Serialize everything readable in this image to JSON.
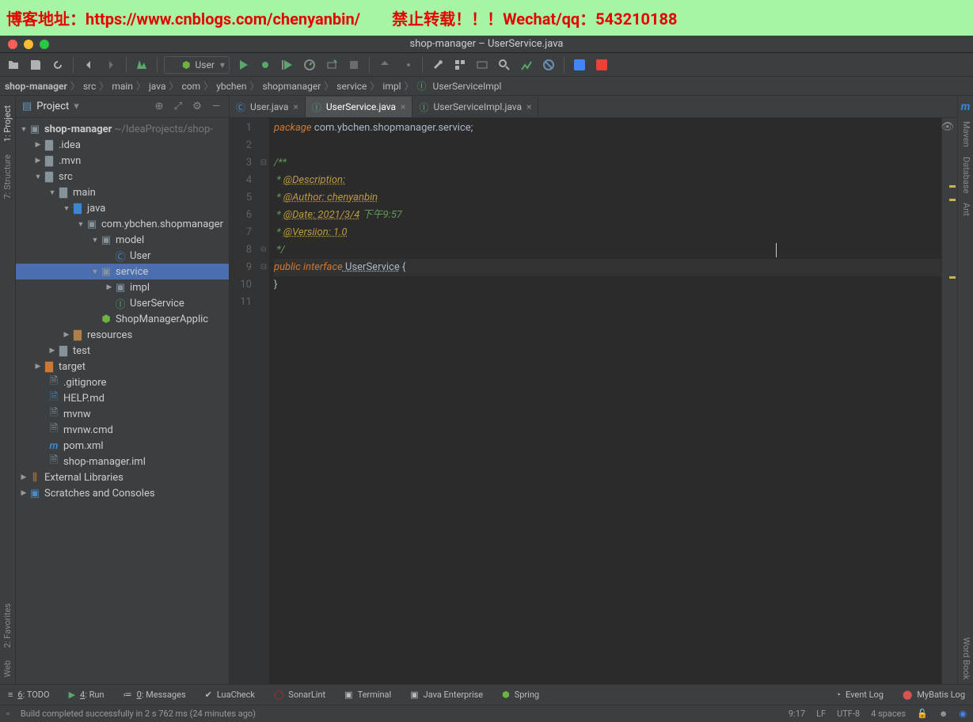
{
  "banner": {
    "blog_label": "博客地址：https://www.cnblogs.com/chenyanbin/",
    "warning": "禁止转载！！！Wechat/qq：543210188"
  },
  "window_title": "shop-manager – UserService.java",
  "run_config": "User",
  "breadcrumbs": [
    "shop-manager",
    "src",
    "main",
    "java",
    "com",
    "ybchen",
    "shopmanager",
    "service",
    "impl",
    "UserServiceImpl"
  ],
  "panel": {
    "title": "Project"
  },
  "tree": {
    "root": "shop-manager",
    "root_path": "~/IdeaProjects/shop-",
    "items": {
      "idea": ".idea",
      "mvn": ".mvn",
      "src": "src",
      "main": "main",
      "java": "java",
      "pkg": "com.ybchen.shopmanager",
      "model": "model",
      "user": "User",
      "service": "service",
      "impl": "impl",
      "userservice": "UserService",
      "app": "ShopManagerApplic",
      "resources": "resources",
      "test": "test",
      "target": "target",
      "gitignore": ".gitignore",
      "help": "HELP.md",
      "mvnw": "mvnw",
      "mvnwcmd": "mvnw.cmd",
      "pom": "pom.xml",
      "iml": "shop-manager.iml",
      "ext": "External Libraries",
      "scratch": "Scratches and Consoles"
    }
  },
  "tabs": [
    {
      "label": "User.java",
      "icon": "class",
      "active": false
    },
    {
      "label": "UserService.java",
      "icon": "interface",
      "active": true
    },
    {
      "label": "UserServiceImpl.java",
      "icon": "interface",
      "active": false
    }
  ],
  "editor": {
    "line_numbers": [
      "1",
      "2",
      "3",
      "4",
      "5",
      "6",
      "7",
      "8",
      "9",
      "10",
      "11"
    ],
    "lines": {
      "package_kw": "package",
      "package_val": " com.ybchen.shopmanager.service;",
      "jdoc_open": "/**",
      "desc_pre": " * ",
      "desc_tag": "@Description:",
      "author_pre": " * ",
      "author_tag": "@Author:",
      "author_val": " chenyanbin",
      "date_pre": " * ",
      "date_tag": "@Date:",
      "date_val": " 2021/3/4",
      "date_time": " 下午9:57",
      "version_pre": " * ",
      "version_tag": "@Versiion:",
      "version_val": " 1.0",
      "jdoc_close": " */",
      "public_kw": "public",
      "interface_kw": " interface",
      "iface_name": " UserService",
      "open_brace": " {",
      "close_brace": "}"
    }
  },
  "bottom_tools": {
    "todo": "TODO",
    "todo_num": "6",
    "run": "Run",
    "run_num": "4",
    "messages": "Messages",
    "messages_num": "0",
    "luacheck": "LuaCheck",
    "sonarlint": "SonarLint",
    "terminal": "Terminal",
    "java_ee": "Java Enterprise",
    "spring": "Spring",
    "eventlog": "Event Log",
    "mybatis": "MyBatis Log"
  },
  "status": {
    "message": "Build completed successfully in 2 s 762 ms (24 minutes ago)",
    "pos": "9:17",
    "sep": "LF",
    "enc": "UTF-8",
    "indent": "4 spaces"
  },
  "left_tools": {
    "project": "1: Project",
    "structure": "7: Structure",
    "favorites": "2: Favorites",
    "web": "Web"
  },
  "right_tools": {
    "maven": "Maven",
    "database": "Database",
    "ant": "Ant",
    "wordbook": "Word Book"
  }
}
